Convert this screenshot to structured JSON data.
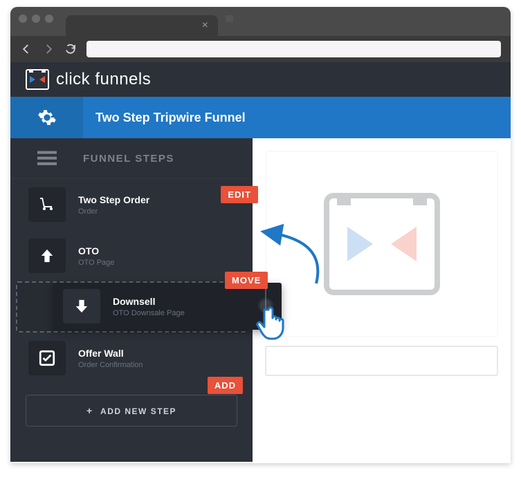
{
  "logo_text": "click funnels",
  "funnel_title": "Two Step Tripwire Funnel",
  "section_label": "FUNNEL STEPS",
  "tags": {
    "edit": "EDIT",
    "move": "MOVE",
    "add": "ADD"
  },
  "steps": [
    {
      "title": "Two Step Order",
      "sub": "Order",
      "icon": "cart"
    },
    {
      "title": "OTO",
      "sub": "OTO Page",
      "icon": "arrow-up"
    },
    {
      "title": "Downsell",
      "sub": "OTO Downsale Page",
      "icon": "arrow-down"
    },
    {
      "title": "Offer Wall",
      "sub": "Order Confirmation",
      "icon": "check"
    }
  ],
  "add_button_label": "ADD NEW STEP"
}
